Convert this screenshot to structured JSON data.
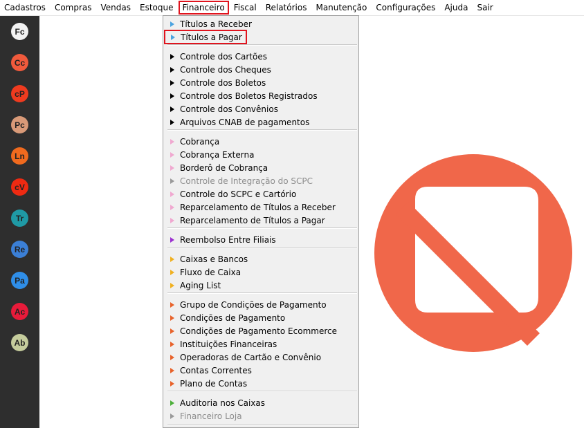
{
  "menubar": {
    "items": [
      "Cadastros",
      "Compras",
      "Vendas",
      "Estoque",
      "Financeiro",
      "Fiscal",
      "Relatórios",
      "Manutenção",
      "Configurações",
      "Ajuda",
      "Sair"
    ]
  },
  "sidebar": {
    "items": [
      {
        "label": "Fc",
        "color": "#f2f2f2"
      },
      {
        "label": "Cc",
        "color": "#f05a3c"
      },
      {
        "label": "cP",
        "color": "#ef3b1f"
      },
      {
        "label": "Pc",
        "color": "#d99a78"
      },
      {
        "label": "Ln",
        "color": "#f06a1e"
      },
      {
        "label": "cV",
        "color": "#ee2a12"
      },
      {
        "label": "Tr",
        "color": "#1f9aa5"
      },
      {
        "label": "Re",
        "color": "#3b7fd6"
      },
      {
        "label": "Pa",
        "color": "#2f8ee8"
      },
      {
        "label": "Ac",
        "color": "#e81b3a"
      },
      {
        "label": "Ab",
        "color": "#c5cc9c"
      }
    ]
  },
  "dropdown": {
    "items": [
      {
        "label": "Títulos a Receber",
        "color": "#4aa3e0"
      },
      {
        "label": "Títulos a Pagar",
        "color": "#4aa3e0",
        "highlighted": true
      },
      {
        "label": "Controle dos Cartões",
        "color": "#000000"
      },
      {
        "label": "Controle dos Cheques",
        "color": "#000000"
      },
      {
        "label": "Controle dos Boletos",
        "color": "#000000"
      },
      {
        "label": "Controle dos Boletos Registrados",
        "color": "#000000"
      },
      {
        "label": "Controle dos Convênios",
        "color": "#000000"
      },
      {
        "label": "Arquivos CNAB de pagamentos",
        "color": "#000000"
      },
      {
        "label": "Cobrança",
        "color": "#f0a8d0"
      },
      {
        "label": "Cobrança Externa",
        "color": "#f0a8d0"
      },
      {
        "label": "Borderô de Cobrança",
        "color": "#f0a8d0"
      },
      {
        "label": "Controle de Integração do SCPC",
        "color": "#9a9a9a",
        "disabled": true
      },
      {
        "label": "Controle do SCPC e Cartório",
        "color": "#f0a8d0"
      },
      {
        "label": "Reparcelamento de Títulos a Receber",
        "color": "#f0a8d0"
      },
      {
        "label": "Reparcelamento de Títulos a Pagar",
        "color": "#f0a8d0"
      },
      {
        "label": "Reembolso Entre Filiais",
        "color": "#9b30d0"
      },
      {
        "label": "Caixas e Bancos",
        "color": "#f0b020"
      },
      {
        "label": "Fluxo de Caixa",
        "color": "#f0b020"
      },
      {
        "label": "Aging List",
        "color": "#f0b020"
      },
      {
        "label": "Grupo de Condições de Pagamento",
        "color": "#e8622a"
      },
      {
        "label": "Condições de Pagamento",
        "color": "#e8622a"
      },
      {
        "label": "Condições de Pagamento Ecommerce",
        "color": "#e8622a"
      },
      {
        "label": "Instituições Financeiras",
        "color": "#e8622a"
      },
      {
        "label": "Operadoras de Cartão e Convênio",
        "color": "#e8622a"
      },
      {
        "label": "Contas Correntes",
        "color": "#e8622a"
      },
      {
        "label": "Plano de Contas",
        "color": "#e8622a"
      },
      {
        "label": "Auditoria nos Caixas",
        "color": "#4caf3a"
      },
      {
        "label": "Financeiro Loja",
        "color": "#9a9a9a",
        "disabled": true
      }
    ]
  },
  "logo": {
    "color": "#f0674a",
    "icon": "brand-logo"
  }
}
